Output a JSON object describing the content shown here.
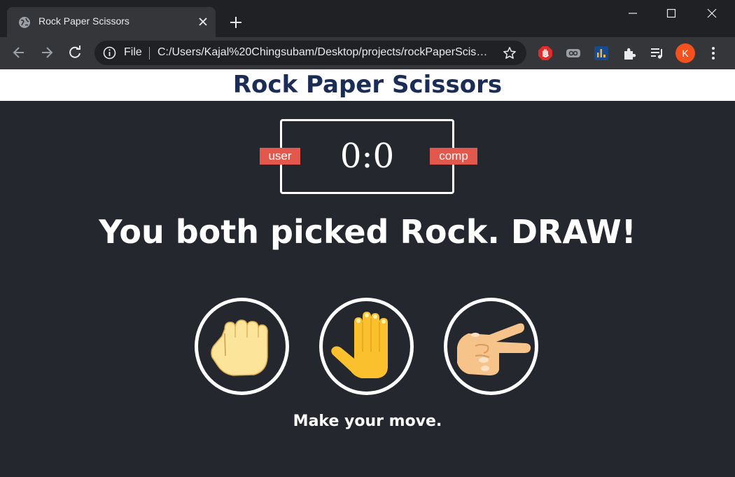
{
  "browser": {
    "tab": {
      "title": "Rock Paper Scissors",
      "favicon": "globe-icon"
    },
    "omnibox": {
      "scheme_label": "File",
      "url": "C:/Users/Kajal%20Chingsubam/Desktop/projects/rockPaperScissors/index.html"
    },
    "profile_initial": "K",
    "colors": {
      "tabstrip": "#202124",
      "toolbar": "#35363a",
      "avatar": "#f4511e"
    }
  },
  "page": {
    "title": "Rock Paper Scissors",
    "scoreboard": {
      "user_label": "user",
      "comp_label": "comp",
      "score": "0:0"
    },
    "result": "You both picked Rock. DRAW!",
    "choices": [
      {
        "name": "Rock",
        "icon": "fist-icon"
      },
      {
        "name": "Paper",
        "icon": "raised-hand-icon"
      },
      {
        "name": "Scissors",
        "icon": "victory-hand-icon"
      }
    ],
    "action_message": "Make your move.",
    "colors": {
      "background": "#24272e",
      "title": "#1b2c55",
      "badge": "#e2584d",
      "header": "#ffffff"
    }
  }
}
